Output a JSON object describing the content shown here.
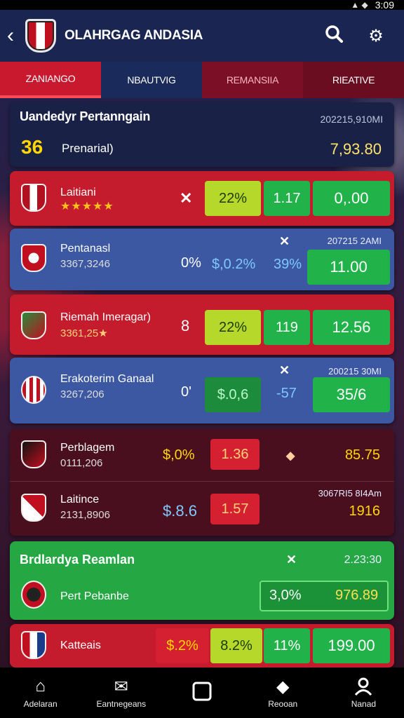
{
  "status": {
    "time": "3:09"
  },
  "app": {
    "title": "OLAHRGAG ANDASIA"
  },
  "tabs": [
    "ZANIANGO",
    "NBAUTVIG",
    "REMANSIIA",
    "RIEATIVE"
  ],
  "summary": {
    "title": "Uandedyr Pertanngain",
    "time": "202215,910MI",
    "number": "36",
    "subtitle": "Prenarial)",
    "value": "7,93.80"
  },
  "rows": [
    {
      "name": "Laitiani",
      "stars": "★★★★★",
      "mark": "✕",
      "pill1": "22%",
      "pill2": "1.17",
      "pill3": "0,.00"
    },
    {
      "name": "Pentanasl",
      "sub": "3367,3246",
      "pct": "0%",
      "mid": "$,0.2%",
      "mid2": "39%",
      "val": "11.00",
      "time": "207215 2AMI",
      "mark": "✕"
    },
    {
      "name": "Riemah Imeragar)",
      "sub": "3361,25★",
      "num": "8",
      "pill1": "22%",
      "pill2": "119",
      "pill3": "12.56"
    },
    {
      "name": "Erakoterim Ganaal",
      "sub": "3267,206",
      "num": "0'",
      "pill1": "$.0,6",
      "mid2": "-57",
      "val": "35/6",
      "time": "200215 30MI",
      "mark": "✕"
    },
    {
      "name": "Perblagem",
      "sub": "0111,206",
      "pct": "$,0%",
      "pill": "1.36",
      "mark": "◆",
      "val": "85.75"
    },
    {
      "name": "Laitince",
      "sub": "2131,8906",
      "pct": "$.8.6",
      "pill": "1.57",
      "val": "1916",
      "time": "3067RI5 8I4Am"
    },
    {
      "name": "Brdlardya Reamlan",
      "time": "2.23:30",
      "mark": "✕",
      "sub": "Pert Pebanbe",
      "pill1": "3,0%",
      "pill2": "976.89"
    },
    {
      "name": "Katteais",
      "pct": "$.2%",
      "pill1": "8.2%",
      "pill2": "11%",
      "val": "199.00"
    }
  ],
  "nav": [
    "Adelaran",
    "Eantnegeans",
    "",
    "Reooan",
    "Nanad"
  ],
  "colors": {
    "accent": "#c8192e",
    "navy": "#1b2552",
    "green": "#25a844"
  }
}
